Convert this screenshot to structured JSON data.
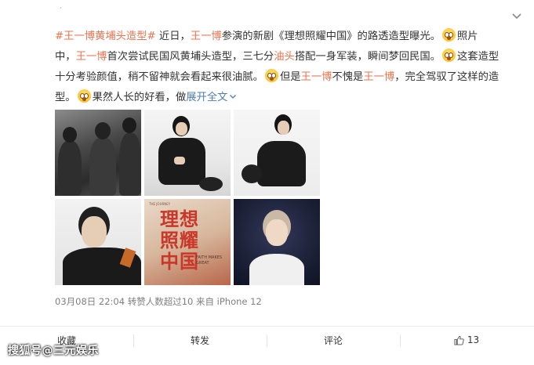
{
  "top_text": "·",
  "post": {
    "line1": {
      "tag": "#王一博黄埔头造型#",
      "t1": " 近日，",
      "name1": "王一博",
      "t2": "参演的新剧《理想照耀中国》的路透造型曝光。",
      "t3": "照片"
    },
    "line2": {
      "t1": "中，",
      "name": "王一博",
      "t2": "首次尝试民国风黄埔头造型，三七分",
      "hair": "油头",
      "t3": "搭配一身军装，瞬间梦回民国。",
      "t4": "这套造型"
    },
    "line3": {
      "t1": "十分考验颜值，稍不留神就会看起来很油腻。",
      "t2": "但是",
      "name1": "王一博",
      "t3": "不愧是",
      "name2": "王一博",
      "t4": "，完全驾驭了这样的造"
    },
    "line4": {
      "t1": "型。",
      "t2": "果然人长的好看，做",
      "expand": "展开全文"
    },
    "emoji_name": "flushed-face-icon"
  },
  "poster": {
    "title_line1": "理想",
    "title_line2": "照耀",
    "title_line3": "中国",
    "sub": "FAITH MAKES GREAT",
    "top": "THE JOURNEY"
  },
  "meta": "03月08日 22:04 转赞人数超过10  来自 iPhone 12",
  "actions": {
    "favorite": "收藏",
    "repost": "转发",
    "comment": "评论",
    "like_count": "13"
  },
  "watermark": "搜狐号@三元娱乐",
  "colors": {
    "highlight": "#eb7350",
    "link": "#507daf",
    "meta": "#808080",
    "poster_red": "#c8372a"
  }
}
